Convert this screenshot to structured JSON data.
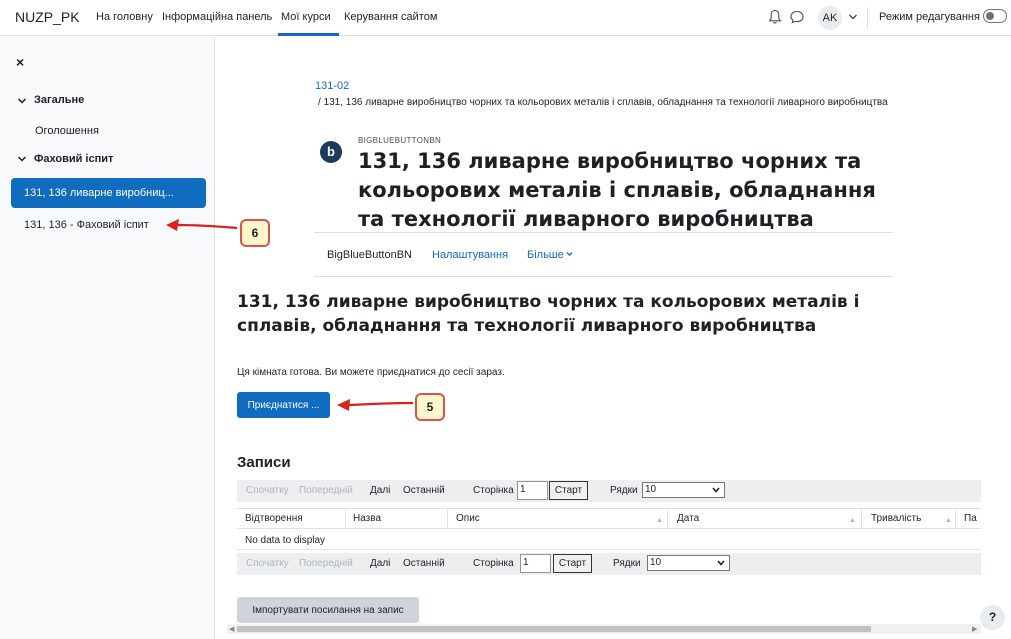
{
  "navbar": {
    "brand": "NUZP_PK",
    "items": [
      "На головну",
      "Інформаційна панель",
      "Мої курси",
      "Керування сайтом"
    ],
    "avatar_initials": "AK",
    "edit_mode_label": "Режим редагування"
  },
  "sidebar": {
    "close_glyph": "×",
    "section1_title": "Загальне",
    "section1_items": [
      "Оголошення"
    ],
    "section2_title": "Фаховий іспит",
    "active_item": "131, 136 ливарне виробниц...",
    "section2_items": [
      "131, 136 - Фаховий іспит"
    ]
  },
  "breadcrumb": {
    "course": "131-02",
    "current": "/ 131, 136 ливарне виробництво чорних та кольорових металів і сплавів, обладнання та технології ливарного виробництва"
  },
  "activity": {
    "icon_letter": "b",
    "type": "BIGBLUEBUTTONBN",
    "title": "131, 136 ливарне виробництво чорних та кольорових металів і сплавів, обладнання та технології ливарного виробництва"
  },
  "tabs": [
    "BigBlueButtonBN",
    "Налаштування",
    "Більше"
  ],
  "main": {
    "heading": "131, 136 ливарне виробництво чорних та кольорових металів і сплавів, обладнання та технології ливарного виробництва",
    "ready_text": "Ця кімната готова. Ви можете приєднатися до сесії зараз.",
    "join_button": "Приєднатися ...",
    "recordings_heading": "Записи",
    "import_button": "Імпортувати посилання на запис"
  },
  "pager": {
    "first": "Спочатку",
    "prev": "Попередній",
    "next": "Далі",
    "last": "Останній",
    "page_label": "Сторінка",
    "page_value": "1",
    "go_button": "Старт",
    "rows_label": "Рядки",
    "rows_value": "10"
  },
  "table": {
    "columns": [
      "Відтворення",
      "Назва",
      "Опис",
      "Дата",
      "Тривалість",
      "Па"
    ],
    "empty_text": "No data to display"
  },
  "annotations": {
    "callout_5": "5",
    "callout_6": "6",
    "arrow_color": "#d9221c"
  },
  "help_glyph": "?",
  "colors": {
    "primary": "#0f6cbf",
    "sidebar_bg": "#f8f9fa"
  }
}
